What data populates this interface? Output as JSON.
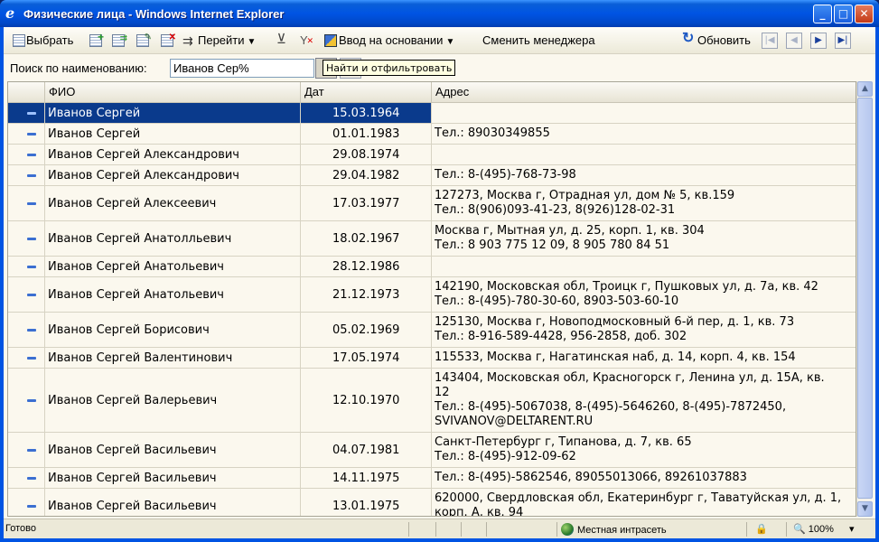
{
  "window": {
    "title": "Физические лица - Windows Internet Explorer",
    "min_glyph": "_",
    "max_glyph": "□",
    "close_glyph": "✕"
  },
  "toolbar": {
    "select_label": "Выбрать",
    "goto_label": "Перейти",
    "basis_label": "Ввод на основании",
    "change_manager_label": "Сменить менеджера",
    "refresh_label": "Обновить",
    "dropdown_glyph": "▼",
    "nav_first": "|◀",
    "nav_prev": "◀",
    "nav_next": "▶",
    "nav_last": "▶|"
  },
  "search": {
    "label": "Поиск по наименованию:",
    "value": "Иванов Сер%",
    "tooltip": "Найти и отфильтровать"
  },
  "grid": {
    "columns": {
      "name": "ФИО",
      "date": "Дат",
      "address": "Адрес"
    },
    "rows": [
      {
        "name": "Иванов Сергей",
        "date": "15.03.1964",
        "address": "",
        "selected": true
      },
      {
        "name": "Иванов Сергей",
        "date": "01.01.1983",
        "address": "Тел.: 89030349855"
      },
      {
        "name": "Иванов Сергей Александрович",
        "date": "29.08.1974",
        "address": ""
      },
      {
        "name": "Иванов Сергей Александрович",
        "date": "29.04.1982",
        "address": "Тел.: 8-(495)-768-73-98"
      },
      {
        "name": "Иванов Сергей Алексеевич",
        "date": "17.03.1977",
        "address": "127273, Москва г, Отрадная ул, дом № 5, кв.159\nТел.: 8(906)093-41-23, 8(926)128-02-31"
      },
      {
        "name": "Иванов Сергей Анатолльевич",
        "date": "18.02.1967",
        "address": "Москва г, Мытная ул, д. 25, корп. 1, кв. 304\nТел.: 8 903 775 12 09, 8 905 780 84 51"
      },
      {
        "name": "Иванов Сергей Анатольевич",
        "date": "28.12.1986",
        "address": ""
      },
      {
        "name": "Иванов Сергей Анатольевич",
        "date": "21.12.1973",
        "address": "142190, Московская обл, Троицк г, Пушковых ул, д. 7а, кв. 42\nТел.: 8-(495)-780-30-60, 8903-503-60-10"
      },
      {
        "name": "Иванов Сергей Борисович",
        "date": "05.02.1969",
        "address": "125130, Москва г, Новоподмосковный 6-й пер, д. 1, кв. 73\nТел.: 8-916-589-4428, 956-2858, доб. 302"
      },
      {
        "name": "Иванов Сергей Валентинович",
        "date": "17.05.1974",
        "address": "115533, Москва г, Нагатинская наб, д. 14, корп. 4, кв. 154"
      },
      {
        "name": "Иванов Сергей Валерьевич",
        "date": "12.10.1970",
        "address": "143404, Московская обл, Красногорск г, Ленина ул, д. 15А, кв.\n12\nТел.: 8-(495)-5067038, 8-(495)-5646260, 8-(495)-7872450,\nSVIVANOV@DELTARENT.RU"
      },
      {
        "name": "Иванов Сергей Васильевич",
        "date": "04.07.1981",
        "address": "Санкт-Петербург г, Типанова, д. 7, кв. 65\nТел.: 8-(495)-912-09-62"
      },
      {
        "name": "Иванов Сергей Васильевич",
        "date": "14.11.1975",
        "address": "Тел.: 8-(495)-5862546, 89055013066, 89261037883"
      },
      {
        "name": "Иванов Сергей Васильевич",
        "date": "13.01.1975",
        "address": "620000, Свердловская обл, Екатеринбург г, Таватуйская ул, д. 1,\nкорп. А, кв. 94"
      }
    ]
  },
  "statusbar": {
    "status": "Готово",
    "zone": "Местная интрасеть",
    "zoom": "100%",
    "zoom_glyph": "🔍",
    "dropdown_glyph": "▾"
  }
}
